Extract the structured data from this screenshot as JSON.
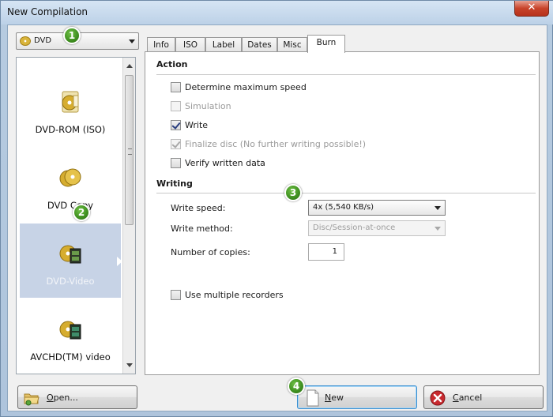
{
  "window": {
    "title": "New Compilation",
    "close_label": "✕"
  },
  "type_dropdown": {
    "value": "DVD"
  },
  "compilation_types": [
    {
      "label": "DVD-ROM (ISO)",
      "icon": "dvd-rom-icon"
    },
    {
      "label": "DVD Copy",
      "icon": "disc-copy-icon"
    },
    {
      "label": "DVD-Video",
      "icon": "dvd-video-icon",
      "selected": true
    },
    {
      "label": "AVCHD(TM) video",
      "icon": "avchd-icon"
    }
  ],
  "tabs": [
    "Info",
    "ISO",
    "Label",
    "Dates",
    "Misc",
    "Burn"
  ],
  "active_tab": "Burn",
  "action": {
    "title": "Action",
    "options": [
      {
        "label": "Determine maximum speed",
        "checked": false,
        "disabled": false
      },
      {
        "label": "Simulation",
        "checked": false,
        "disabled": true
      },
      {
        "label": "Write",
        "checked": true,
        "disabled": false
      },
      {
        "label": "Finalize disc (No further writing possible!)",
        "checked": true,
        "disabled": true
      },
      {
        "label": "Verify written data",
        "checked": false,
        "disabled": false
      }
    ]
  },
  "writing": {
    "title": "Writing",
    "write_speed_label": "Write speed:",
    "write_speed_value": "4x (5,540 KB/s)",
    "write_method_label": "Write method:",
    "write_method_value": "Disc/Session-at-once",
    "copies_label": "Number of copies:",
    "copies_value": "1",
    "multiple_recorders_label": "Use multiple recorders"
  },
  "buttons": {
    "open_underlined": "O",
    "open_rest": "pen...",
    "new_underlined": "N",
    "new_rest": "ew",
    "cancel_underlined": "C",
    "cancel_rest": "ancel"
  },
  "badges": [
    "1",
    "2",
    "3",
    "4"
  ],
  "colors": {
    "badge_green": "#3e8e1f",
    "selected_item": "#c7d3e6",
    "default_button_border": "#3b8fd0",
    "cancel_red": "#c8292e"
  }
}
